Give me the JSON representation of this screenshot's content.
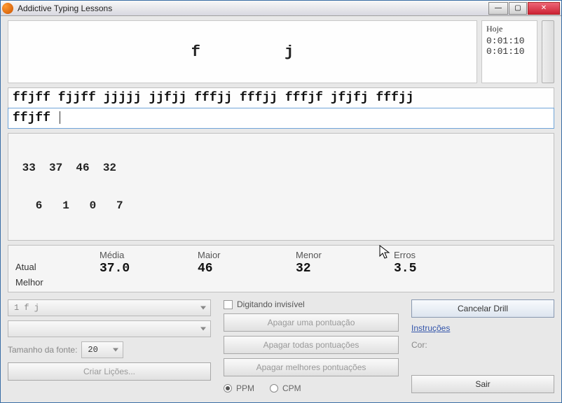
{
  "window": {
    "title": "Addictive Typing Lessons"
  },
  "lesson": {
    "left": "f",
    "right": "j"
  },
  "timer": {
    "label": "Hoje",
    "t1": "0:01:10",
    "t2": "0:01:10"
  },
  "typing": {
    "target": "ffjff fjjff jjjjj jjfjj fffjj fffjj fffjf jfjfj fffjj",
    "typed": "ffjff "
  },
  "numbers": {
    "row1": " 33  37  46  32",
    "row2": "   6   1   0   7"
  },
  "stats": {
    "headers": {
      "media": "Média",
      "maior": "Maior",
      "menor": "Menor",
      "erros": "Erros"
    },
    "rows": {
      "atual": "Atual",
      "melhor": "Melhor"
    },
    "values": {
      "media": "37.0",
      "maior": "46",
      "menor": "32",
      "erros": "3.5"
    }
  },
  "left": {
    "combo1": "1  f j",
    "combo2": "",
    "fontlabel": "Tamanho da fonte:",
    "fontvalue": "20",
    "createBtn": "Criar Lições..."
  },
  "mid": {
    "invisible": "Digitando invisível",
    "del1": "Apagar uma pontuação",
    "delAll": "Apagar todas pontuações",
    "delBest": "Apagar melhores pontuações",
    "ppm": "PPM",
    "cpm": "CPM"
  },
  "right": {
    "cancel": "Cancelar Drill",
    "instructions": "Instruções",
    "color": "Cor:",
    "exit": "Sair"
  }
}
